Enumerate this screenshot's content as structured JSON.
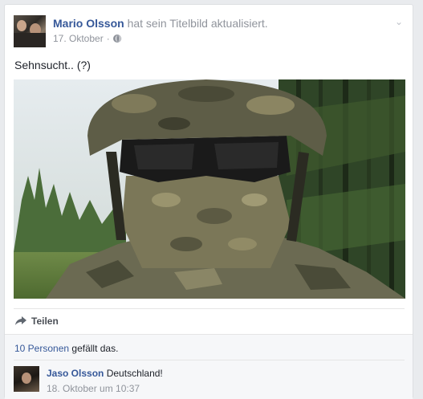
{
  "post": {
    "author": "Mario Olsson",
    "action": "hat sein Titelbild aktualisiert.",
    "date": "17. Oktober",
    "separator": "·",
    "text": "Sehnsucht.. (?)"
  },
  "actions": {
    "share_label": "Teilen"
  },
  "likes": {
    "count_link": "10 Personen",
    "suffix": "gefällt das."
  },
  "comment": {
    "author": "Jaso Olsson",
    "text": "Deutschland!",
    "time": "18. Oktober um 10:37"
  },
  "icons": {
    "audience": "globe-icon",
    "menu": "chevron-down-icon",
    "share": "share-arrow-icon"
  },
  "colors": {
    "link": "#365899",
    "meta": "#90949c",
    "text": "#1d2129"
  }
}
